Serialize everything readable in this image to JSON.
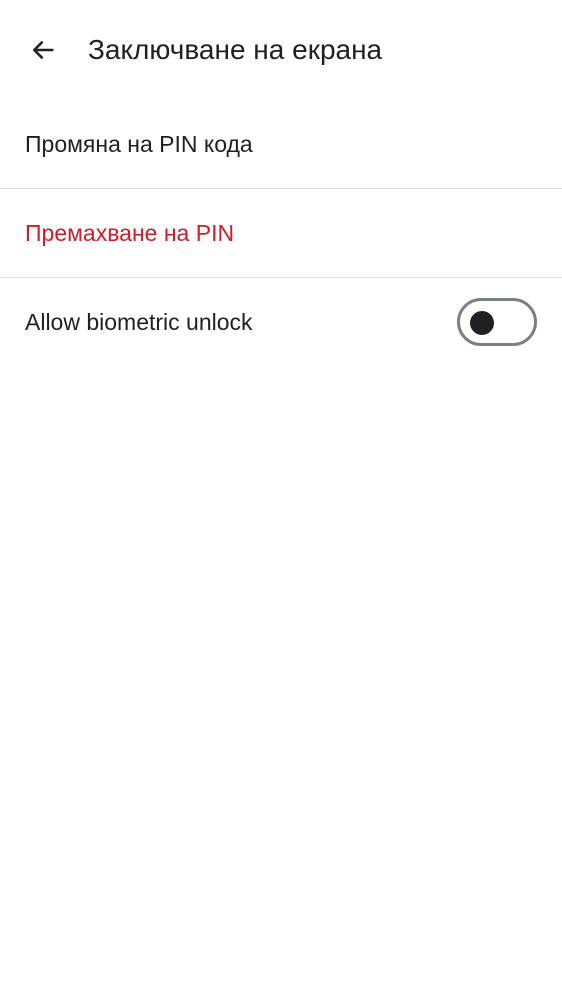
{
  "app_bar": {
    "back_icon": "arrow-left-icon",
    "title": "Заключване на екрана"
  },
  "settings": {
    "change_pin_label": "Промяна на PIN кода",
    "remove_pin_label": "Премахване на PIN",
    "biometric_label": "Allow biometric unlock",
    "biometric_enabled": false
  },
  "colors": {
    "text": "#1f1f24",
    "danger": "#d21b29",
    "divider": "#dedee2",
    "toggle_outline": "#7b7f88"
  }
}
